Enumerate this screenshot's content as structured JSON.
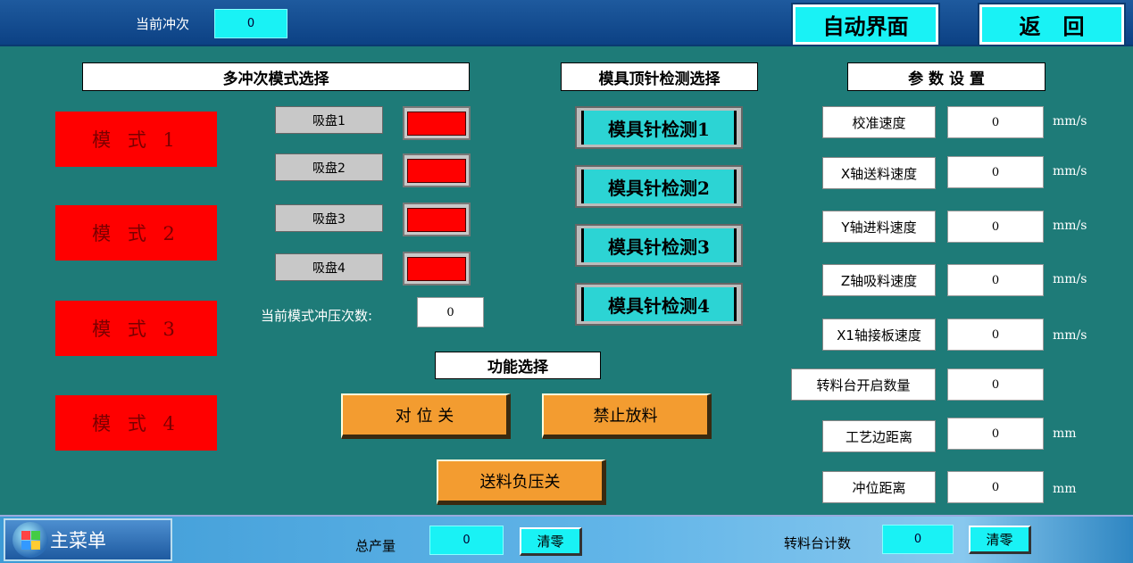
{
  "header": {
    "current_strokes_label": "当前冲次",
    "current_strokes_value": "0",
    "auto_button": "自动界面",
    "back_button": "返   回"
  },
  "mode_section": {
    "title": "多冲次模式选择",
    "modes": [
      "模 式 1",
      "模 式 2",
      "模 式 3",
      "模 式 4"
    ]
  },
  "suction": {
    "cups": [
      "吸盘1",
      "吸盘2",
      "吸盘3",
      "吸盘4"
    ],
    "lamp_color": "#ff0000",
    "count_label": "当前模式冲压次数:",
    "count_value": "0"
  },
  "mold_section": {
    "title": "模具顶针检测选择",
    "buttons": [
      "模具针检测1",
      "模具针检测2",
      "模具针检测3",
      "模具针检测4"
    ]
  },
  "function_section": {
    "title": "功能选择",
    "align_button": "对 位 关",
    "no_discharge_button": "禁止放料",
    "feed_vacuum_button": "送料负压关"
  },
  "params": {
    "title": "参 数 设 置",
    "items": [
      {
        "label": "校准速度",
        "value": "0",
        "unit": "mm/s"
      },
      {
        "label": "X轴送料速度",
        "value": "0",
        "unit": "mm/s"
      },
      {
        "label": "Y轴进料速度",
        "value": "0",
        "unit": "mm/s"
      },
      {
        "label": "Z轴吸料速度",
        "value": "0",
        "unit": "mm/s"
      },
      {
        "label": "X1轴接板速度",
        "value": "0",
        "unit": "mm/s"
      },
      {
        "label": "转料台开启数量",
        "value": "0",
        "unit": ""
      },
      {
        "label": "工艺边距离",
        "value": "0",
        "unit": "mm"
      },
      {
        "label": "冲位距离",
        "value": "0",
        "unit": "mm"
      }
    ]
  },
  "footer": {
    "main_menu": "主菜单",
    "total_output_label": "总产量",
    "total_output_value": "0",
    "clear1": "清零",
    "turntable_count_label": "转料台计数",
    "turntable_count_value": "0",
    "clear2": "清零"
  },
  "colors": {
    "background": "#1e7b78",
    "cyan": "#19f2f5",
    "alarm_red": "#ff0000",
    "orange": "#f39c30"
  }
}
